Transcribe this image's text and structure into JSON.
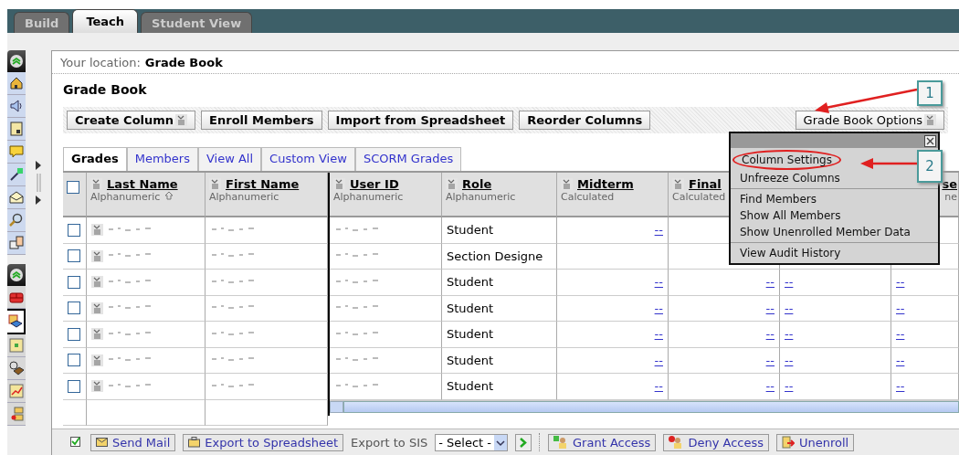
{
  "top_tabs": [
    {
      "label": "Build",
      "selected": false
    },
    {
      "label": "Teach",
      "selected": true
    },
    {
      "label": "Student View",
      "selected": false
    }
  ],
  "sidebar": {
    "groups": [
      {
        "items": [
          {
            "kind": "home",
            "selected": false
          },
          {
            "kind": "speaker",
            "selected": false
          },
          {
            "kind": "calendar",
            "selected": false
          },
          {
            "kind": "chat",
            "selected": false
          },
          {
            "kind": "wand",
            "selected": false
          },
          {
            "kind": "mail",
            "selected": false
          },
          {
            "kind": "search",
            "selected": false
          },
          {
            "kind": "documents",
            "selected": false
          }
        ]
      },
      {
        "items": [
          {
            "kind": "bricks",
            "selected": false
          },
          {
            "kind": "books",
            "selected": true
          },
          {
            "kind": "grid",
            "selected": false
          },
          {
            "kind": "reel",
            "selected": false
          },
          {
            "kind": "chart",
            "selected": false
          },
          {
            "kind": "tree",
            "selected": false
          }
        ]
      }
    ]
  },
  "location": {
    "label": "Your location:",
    "value": "Grade Book"
  },
  "page_title": "Grade Book",
  "toolbar": {
    "buttons": [
      {
        "label": "Create Column",
        "dropdown": true
      },
      {
        "label": "Enroll Members",
        "dropdown": false
      },
      {
        "label": "Import from Spreadsheet",
        "dropdown": false
      },
      {
        "label": "Reorder Columns",
        "dropdown": false
      }
    ],
    "options_button": "Grade Book Options"
  },
  "view_tabs": [
    {
      "label": "Grades",
      "selected": true
    },
    {
      "label": "Members",
      "selected": false
    },
    {
      "label": "View All",
      "selected": false
    },
    {
      "label": "Custom View",
      "selected": false
    },
    {
      "label": "SCORM Grades",
      "selected": false
    }
  ],
  "table": {
    "columns": [
      {
        "title": "Last Name",
        "subtitle": "Alphanumeric",
        "sorted": true
      },
      {
        "title": "First Name",
        "subtitle": "Alphanumeric",
        "sorted": false
      },
      {
        "title": "User ID",
        "subtitle": "Alphanumeric",
        "sorted": false
      },
      {
        "title": "Role",
        "subtitle": "Alphanumeric",
        "sorted": false
      },
      {
        "title": "Midterm",
        "subtitle": "Calculated",
        "sorted": false
      },
      {
        "title": "Final",
        "subtitle": "Calculated",
        "sorted": false
      },
      {
        "title": "se",
        "subtitle": "ne",
        "sorted": false
      }
    ],
    "select_all_checked": false,
    "rows": [
      {
        "checked": false,
        "role": "Student",
        "grades": [
          "--"
        ]
      },
      {
        "checked": false,
        "role": "Section Designe"
      },
      {
        "checked": false,
        "role": "Student",
        "grades": [
          "--",
          "--",
          "--",
          "--"
        ]
      },
      {
        "checked": false,
        "role": "Student",
        "grades": [
          "--",
          "--",
          "--",
          "--"
        ]
      },
      {
        "checked": false,
        "role": "Student",
        "grades": [
          "--",
          "--",
          "--",
          "--"
        ]
      },
      {
        "checked": false,
        "role": "Student",
        "grades": [
          "--",
          "--",
          "--",
          "--"
        ]
      },
      {
        "checked": false,
        "role": "Student",
        "grades": [
          "--",
          "--",
          "--",
          "--"
        ]
      }
    ]
  },
  "options_menu": {
    "groups": [
      [
        {
          "label": "Column Settings",
          "circled": true
        },
        {
          "label": "Unfreeze Columns",
          "circled": false
        }
      ],
      [
        {
          "label": "Find Members",
          "circled": false
        },
        {
          "label": "Show All Members",
          "circled": false
        },
        {
          "label": "Show Unenrolled Member Data",
          "circled": false
        }
      ],
      [
        {
          "label": "View Audit History",
          "circled": false
        }
      ]
    ]
  },
  "callouts": [
    "1",
    "2"
  ],
  "footer": {
    "send_mail": "Send Mail",
    "export_spreadsheet": "Export to Spreadsheet",
    "sis_label": "Export to SIS",
    "sis_select": "- Select -",
    "actions": [
      {
        "kind": "grant",
        "label": "Grant Access"
      },
      {
        "kind": "deny",
        "label": "Deny Access"
      },
      {
        "kind": "unenroll",
        "label": "Unenroll"
      }
    ]
  }
}
